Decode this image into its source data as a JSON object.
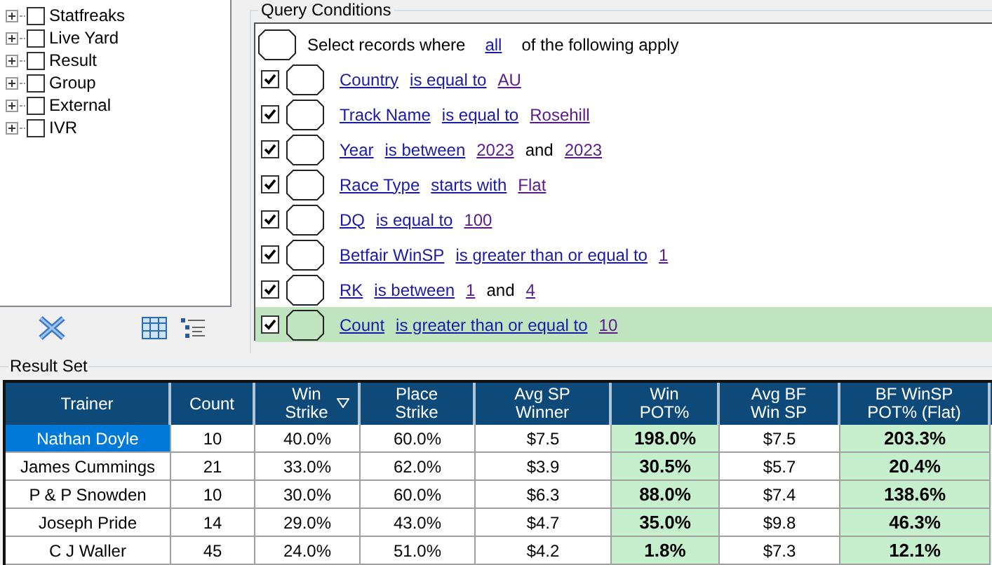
{
  "tree": {
    "items": [
      {
        "label": "Statfreaks",
        "checked": false,
        "expanded": false
      },
      {
        "label": "Live Yard",
        "checked": false,
        "expanded": false
      },
      {
        "label": "Result",
        "checked": false,
        "expanded": false
      },
      {
        "label": "Group",
        "checked": false,
        "expanded": false
      },
      {
        "label": "External",
        "checked": false,
        "expanded": false
      },
      {
        "label": "IVR",
        "checked": false,
        "expanded": false
      }
    ]
  },
  "query": {
    "title": "Query Conditions",
    "header": [
      {
        "kind": "text",
        "text": "Select records where"
      },
      {
        "kind": "link",
        "text": "all"
      },
      {
        "kind": "text",
        "text": "of the following apply"
      }
    ],
    "conditions": [
      {
        "checked": true,
        "selected": false,
        "parts": [
          {
            "kind": "field",
            "text": "Country"
          },
          {
            "kind": "field",
            "text": "is equal to"
          },
          {
            "kind": "value",
            "text": "AU"
          }
        ]
      },
      {
        "checked": true,
        "selected": false,
        "parts": [
          {
            "kind": "field",
            "text": "Track Name"
          },
          {
            "kind": "field",
            "text": "is equal to"
          },
          {
            "kind": "value",
            "text": "Rosehill"
          }
        ]
      },
      {
        "checked": true,
        "selected": false,
        "parts": [
          {
            "kind": "field",
            "text": "Year"
          },
          {
            "kind": "field",
            "text": "is between"
          },
          {
            "kind": "value",
            "text": "2023"
          },
          {
            "kind": "text",
            "text": "and"
          },
          {
            "kind": "value",
            "text": "2023"
          }
        ]
      },
      {
        "checked": true,
        "selected": false,
        "parts": [
          {
            "kind": "field",
            "text": "Race Type"
          },
          {
            "kind": "field",
            "text": "starts with"
          },
          {
            "kind": "value",
            "text": "Flat"
          }
        ]
      },
      {
        "checked": true,
        "selected": false,
        "parts": [
          {
            "kind": "field",
            "text": "DQ"
          },
          {
            "kind": "field",
            "text": "is equal to"
          },
          {
            "kind": "value",
            "text": "100"
          }
        ]
      },
      {
        "checked": true,
        "selected": false,
        "parts": [
          {
            "kind": "field",
            "text": "Betfair WinSP"
          },
          {
            "kind": "field",
            "text": "is greater than or equal to"
          },
          {
            "kind": "value",
            "text": "1"
          }
        ]
      },
      {
        "checked": true,
        "selected": false,
        "parts": [
          {
            "kind": "field",
            "text": "RK"
          },
          {
            "kind": "field",
            "text": "is between"
          },
          {
            "kind": "value",
            "text": "1"
          },
          {
            "kind": "text",
            "text": "and"
          },
          {
            "kind": "value",
            "text": "4"
          }
        ]
      },
      {
        "checked": true,
        "selected": true,
        "parts": [
          {
            "kind": "field",
            "text": "Count"
          },
          {
            "kind": "field",
            "text": "is greater than or equal to"
          },
          {
            "kind": "value",
            "text": "10"
          }
        ]
      }
    ]
  },
  "result_set": {
    "title": "Result Set",
    "columns": [
      {
        "lines": [
          "Trainer"
        ],
        "highlighted": false,
        "sorted": false
      },
      {
        "lines": [
          "Count"
        ],
        "highlighted": false,
        "sorted": false
      },
      {
        "lines": [
          "Win",
          "Strike"
        ],
        "highlighted": false,
        "sorted": true
      },
      {
        "lines": [
          "Place",
          "Strike"
        ],
        "highlighted": false,
        "sorted": false
      },
      {
        "lines": [
          "Avg SP",
          "Winner"
        ],
        "highlighted": false,
        "sorted": false
      },
      {
        "lines": [
          "Win",
          "POT%"
        ],
        "highlighted": true,
        "sorted": false
      },
      {
        "lines": [
          "Avg BF",
          "Win SP"
        ],
        "highlighted": false,
        "sorted": false
      },
      {
        "lines": [
          "BF WinSP",
          "POT% (Flat)"
        ],
        "highlighted": true,
        "sorted": false
      }
    ],
    "rows": [
      {
        "selected": true,
        "cells": [
          "Nathan Doyle",
          "10",
          "40.0%",
          "60.0%",
          "$7.5",
          "198.0%",
          "$7.5",
          "203.3%"
        ]
      },
      {
        "selected": false,
        "cells": [
          "James Cummings",
          "21",
          "33.0%",
          "62.0%",
          "$3.9",
          "30.5%",
          "$5.7",
          "20.4%"
        ]
      },
      {
        "selected": false,
        "cells": [
          "P & P Snowden",
          "10",
          "30.0%",
          "60.0%",
          "$6.3",
          "88.0%",
          "$7.4",
          "138.6%"
        ]
      },
      {
        "selected": false,
        "cells": [
          "Joseph Pride",
          "14",
          "29.0%",
          "43.0%",
          "$4.7",
          "35.0%",
          "$9.8",
          "46.3%"
        ]
      },
      {
        "selected": false,
        "cells": [
          "C J Waller",
          "45",
          "24.0%",
          "51.0%",
          "$4.2",
          "1.8%",
          "$7.3",
          "12.1%"
        ]
      }
    ]
  }
}
